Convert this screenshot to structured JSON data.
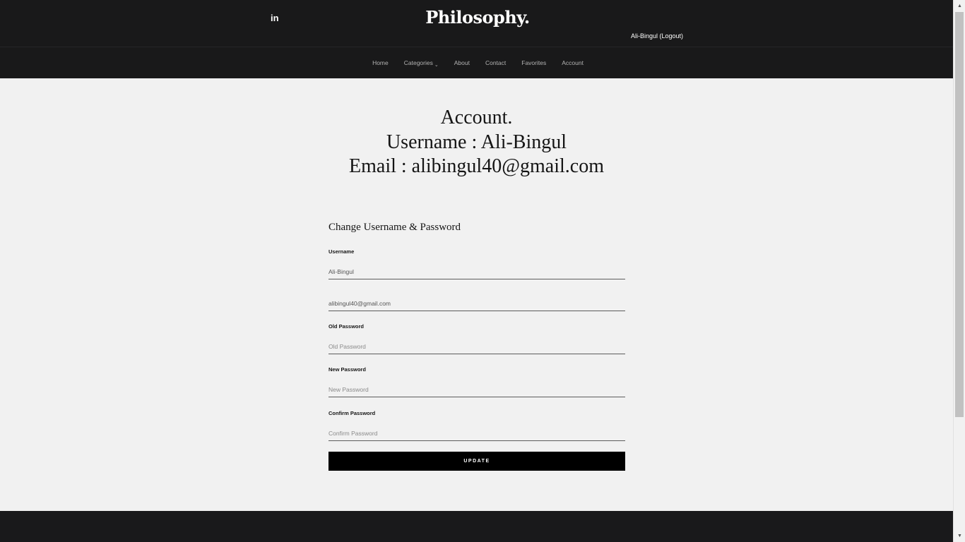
{
  "header": {
    "social_icon": "linkedin-icon",
    "social_text": "in",
    "logo": "Philosophy.",
    "user_link": "Ali-Bingul (Logout)"
  },
  "nav": {
    "items": [
      {
        "label": "Home"
      },
      {
        "label": "Categories",
        "caret": "⌄"
      },
      {
        "label": "About"
      },
      {
        "label": "Contact"
      },
      {
        "label": "Favorites"
      },
      {
        "label": "Account"
      }
    ]
  },
  "account": {
    "title": "Account.",
    "username_line": "Username : Ali-Bingul",
    "email_line": "Email : alibingul40@gmail.com"
  },
  "form": {
    "title": "Change Username & Password",
    "username_label": "Username",
    "username_value": "Ali-Bingul",
    "email_value": "alibingul40@gmail.com",
    "old_password_label": "Old Password",
    "old_password_placeholder": "Old Password",
    "new_password_label": "New Password",
    "new_password_placeholder": "New Password",
    "confirm_password_label": "Confirm Password",
    "confirm_password_placeholder": "Confirm Password",
    "update_button": "UPDATE"
  },
  "scrollbar": {
    "up_arrow": "▲",
    "down_arrow": "▼"
  }
}
